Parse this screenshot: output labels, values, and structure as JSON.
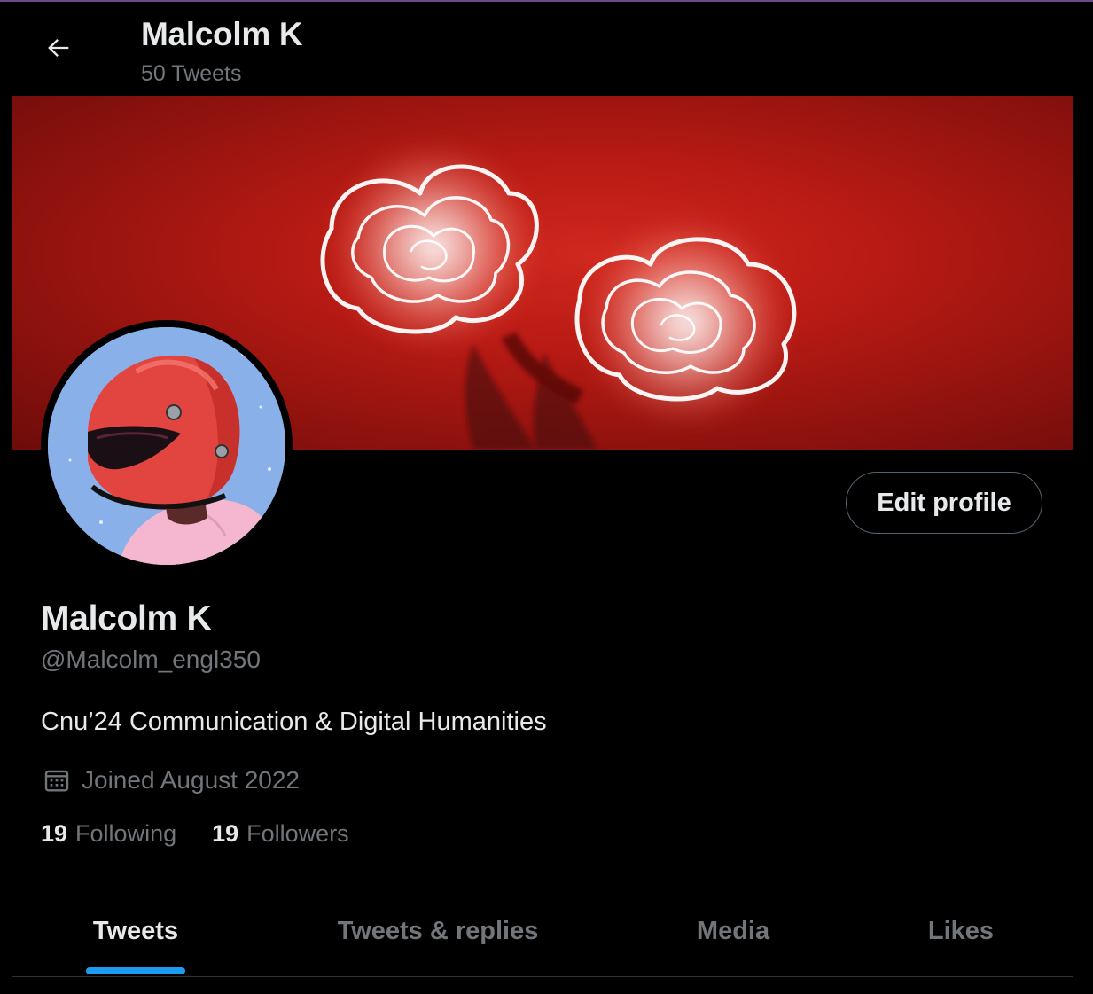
{
  "header": {
    "title": "Malcolm K",
    "tweet_count": "50 Tweets",
    "back_icon": "arrow-left-icon"
  },
  "profile": {
    "display_name": "Malcolm K",
    "handle": "@Malcolm_engl350",
    "bio": "Cnu’24 Communication & Digital Humanities",
    "joined": "Joined August 2022",
    "joined_icon": "calendar-icon",
    "edit_button_label": "Edit profile"
  },
  "stats": {
    "following_count": "19",
    "following_label": "Following",
    "followers_count": "19",
    "followers_label": "Followers"
  },
  "tabs": [
    {
      "label": "Tweets",
      "active": true
    },
    {
      "label": "Tweets & replies",
      "active": false
    },
    {
      "label": "Media",
      "active": false
    },
    {
      "label": "Likes",
      "active": false
    }
  ],
  "colors": {
    "background": "#000000",
    "text_primary": "#e7e9ea",
    "text_secondary": "#71767b",
    "accent": "#1d9bf0",
    "banner_red": "#b81a14"
  }
}
